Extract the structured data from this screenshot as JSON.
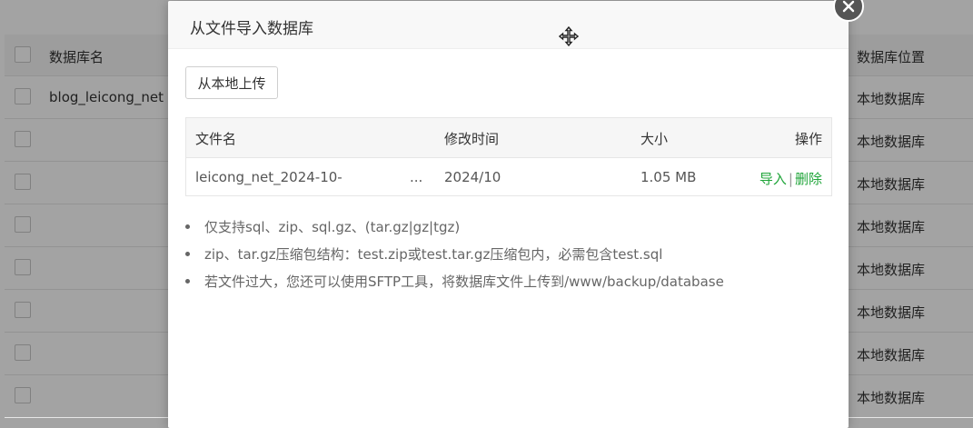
{
  "background_table": {
    "header": {
      "name_label": "数据库名",
      "location_label": "数据库位置"
    },
    "rows": [
      {
        "name": "blog_leicong_net",
        "location": "本地数据库"
      },
      {
        "name": "",
        "location": "本地数据库"
      },
      {
        "name": "",
        "location": "本地数据库"
      },
      {
        "name": "",
        "location": "本地数据库"
      },
      {
        "name": "",
        "location": "本地数据库"
      },
      {
        "name": "",
        "location": "本地数据库"
      },
      {
        "name": "",
        "location": "本地数据库"
      },
      {
        "name": "",
        "location": "本地数据库"
      }
    ]
  },
  "modal": {
    "title": "从文件导入数据库",
    "upload_button": "从本地上传",
    "table": {
      "headers": {
        "filename": "文件名",
        "modified": "修改时间",
        "size": "大小",
        "actions": "操作"
      },
      "rows": [
        {
          "filename": "leicong_net_2024-10-",
          "ellipsis": "...",
          "modified": "2024/10",
          "size": "1.05 MB",
          "import_label": "导入",
          "separator": "|",
          "delete_label": "删除"
        }
      ]
    },
    "notes": [
      "仅支持sql、zip、sql.gz、(tar.gz|gz|tgz)",
      "zip、tar.gz压缩包结构：test.zip或test.tar.gz压缩包内，必需包含test.sql",
      "若文件过大，您还可以使用SFTP工具，将数据库文件上传到/www/backup/database"
    ]
  },
  "colors": {
    "accent_green": "#20a53a",
    "overlay": "rgba(0,0,0,0.36)"
  },
  "icons": {
    "move": "move-icon",
    "close": "close-icon"
  }
}
